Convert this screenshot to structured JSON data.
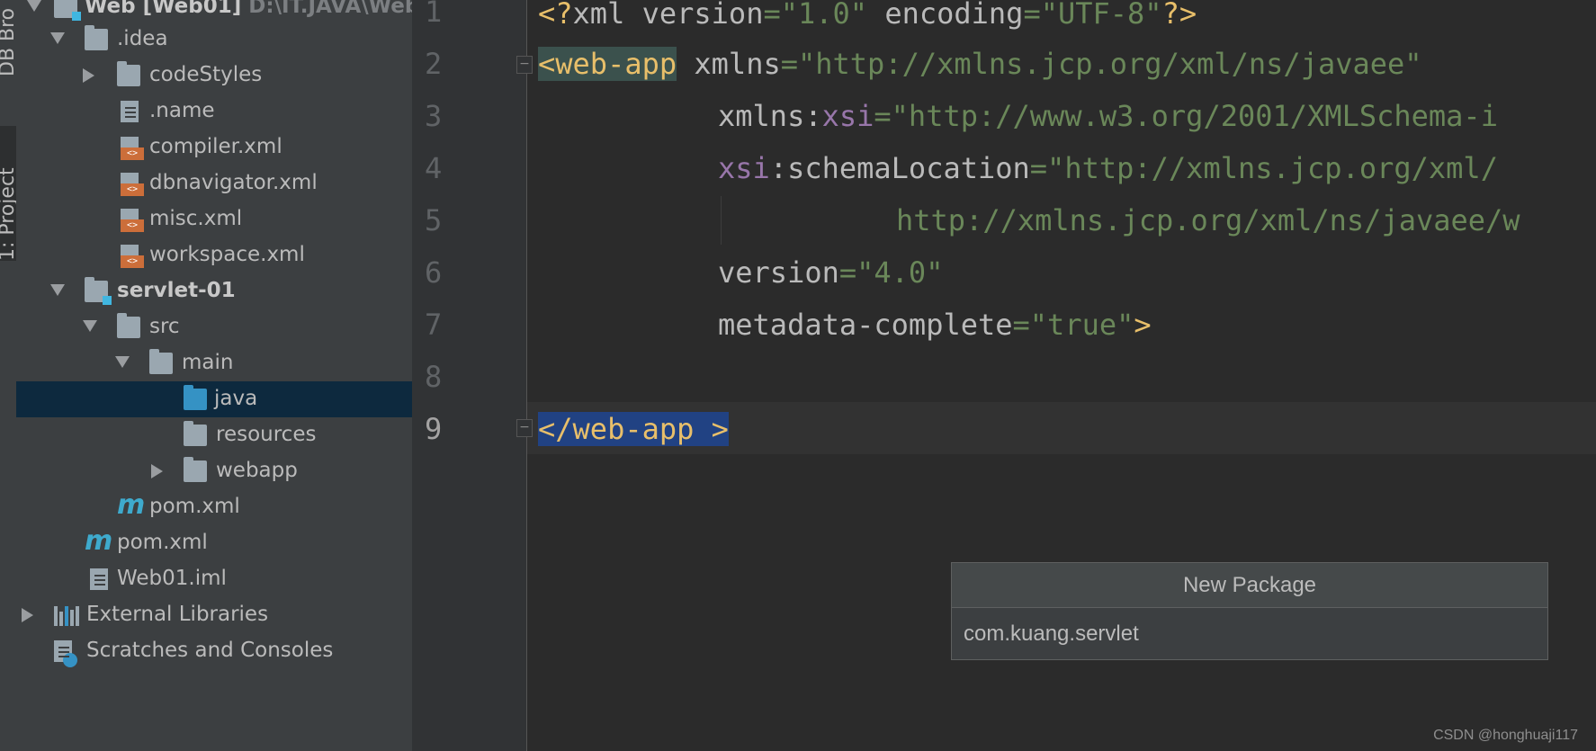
{
  "toolstrip": {
    "db_tab": "DB Bro",
    "project_tab": "1: Project"
  },
  "tree": {
    "root_label": "Web [Web01]",
    "root_path": "D:\\IT.JAVA\\Web",
    "items": [
      {
        "label": ".idea"
      },
      {
        "label": "codeStyles"
      },
      {
        "label": ".name"
      },
      {
        "label": "compiler.xml"
      },
      {
        "label": "dbnavigator.xml"
      },
      {
        "label": "misc.xml"
      },
      {
        "label": "workspace.xml"
      },
      {
        "label": "servlet-01"
      },
      {
        "label": "src"
      },
      {
        "label": "main"
      },
      {
        "label": "java"
      },
      {
        "label": "resources"
      },
      {
        "label": "webapp"
      },
      {
        "label": "pom.xml"
      },
      {
        "label": "pom.xml"
      },
      {
        "label": "Web01.iml"
      },
      {
        "label": "External Libraries"
      },
      {
        "label": "Scratches and Consoles"
      }
    ]
  },
  "editor": {
    "line_numbers": [
      "1",
      "2",
      "3",
      "4",
      "5",
      "6",
      "7",
      "8",
      "9"
    ],
    "code": {
      "l1": {
        "open": "<?",
        "name": "xml",
        "a1": " version",
        "eq1": "=",
        "v1": "\"1.0\"",
        "a2": " encoding",
        "eq2": "=",
        "v2": "\"UTF-8\"",
        "close": "?>"
      },
      "l2": {
        "tag": "<web-app",
        "attr": " xmlns",
        "eq": "=",
        "val": "\"http://xmlns.jcp.org/xml/ns/javaee\""
      },
      "l3": {
        "attr": "xmlns:",
        "ns": "xsi",
        "eq": "=",
        "val": "\"http://www.w3.org/2001/XMLSchema-i"
      },
      "l4": {
        "ns": "xsi",
        "attr": ":schemaLocation",
        "eq": "=",
        "val": "\"http://xmlns.jcp.org/xml/"
      },
      "l5": {
        "val": "http://xmlns.jcp.org/xml/ns/javaee/w"
      },
      "l6": {
        "attr": "version",
        "eq": "=",
        "val": "\"4.0\""
      },
      "l7": {
        "attr": "metadata-complete",
        "eq": "=",
        "val": "\"true\"",
        "close": ">"
      },
      "l9": {
        "tag": "</web-app >"
      }
    }
  },
  "dialog": {
    "title": "New Package",
    "input_value": "com.kuang.servlet"
  },
  "watermark": "CSDN @honghuaji117",
  "colors": {
    "tag": "#e8bf6a",
    "string": "#6a8759",
    "namespace": "#9876aa",
    "selection": "#0d293e",
    "highlight_blue": "#214283"
  }
}
